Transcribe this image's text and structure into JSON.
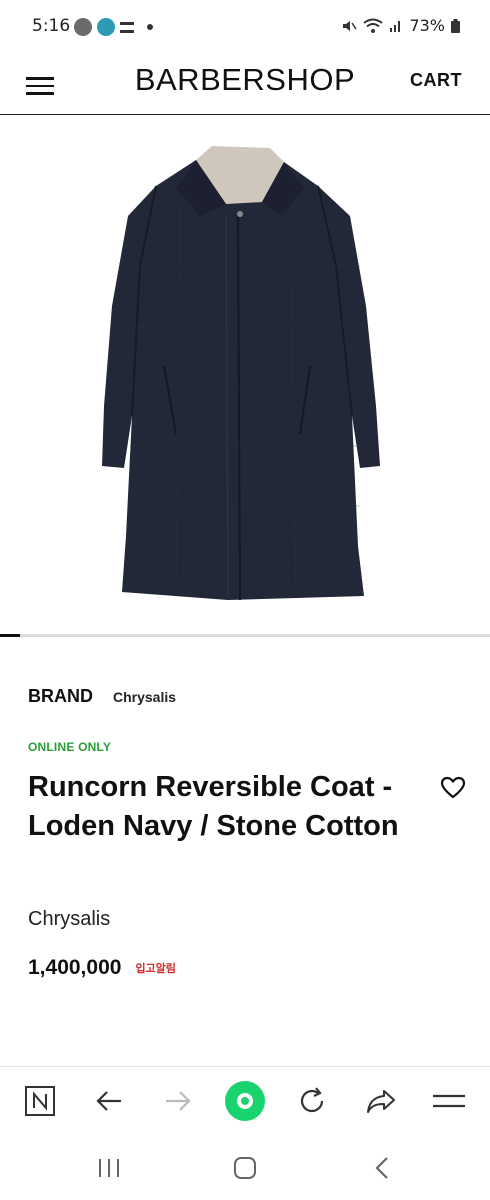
{
  "status_bar": {
    "time": "5:16",
    "battery": "73%",
    "icons": [
      "talk-icon",
      "chat-bubble-icon",
      "avatar-icon",
      "wallet-icon",
      "dot-icon",
      "mute-icon",
      "wifi-icon",
      "signal-icon",
      "battery-icon"
    ]
  },
  "header": {
    "logo": "BARBERSHOP",
    "cart_label": "CART",
    "menu_icon": "hamburger-icon"
  },
  "gallery": {
    "image_alt": "navy reversible coat",
    "progress_fraction": 0.04
  },
  "product": {
    "brand_label": "BRAND",
    "brand_value": "Chrysalis",
    "badge": "ONLINE ONLY",
    "title": "Runcorn Reversible Coat - Loden Navy / Stone Cotton",
    "maker": "Chrysalis",
    "price": "1,400,000",
    "restock_label": "입고알림",
    "wishlist_icon": "heart-icon"
  },
  "browser_toolbar": {
    "buttons": [
      "naver-n-icon",
      "back-arrow-icon",
      "forward-arrow-icon",
      "home-green-circle-icon",
      "reload-icon",
      "share-icon",
      "menu-lines-icon"
    ],
    "accent": "#19d36e"
  },
  "system_nav": {
    "buttons": [
      "recent-apps-icon",
      "home-icon",
      "back-icon"
    ]
  },
  "colors": {
    "online_only": "#2aa036",
    "restock": "#d22a2a"
  }
}
